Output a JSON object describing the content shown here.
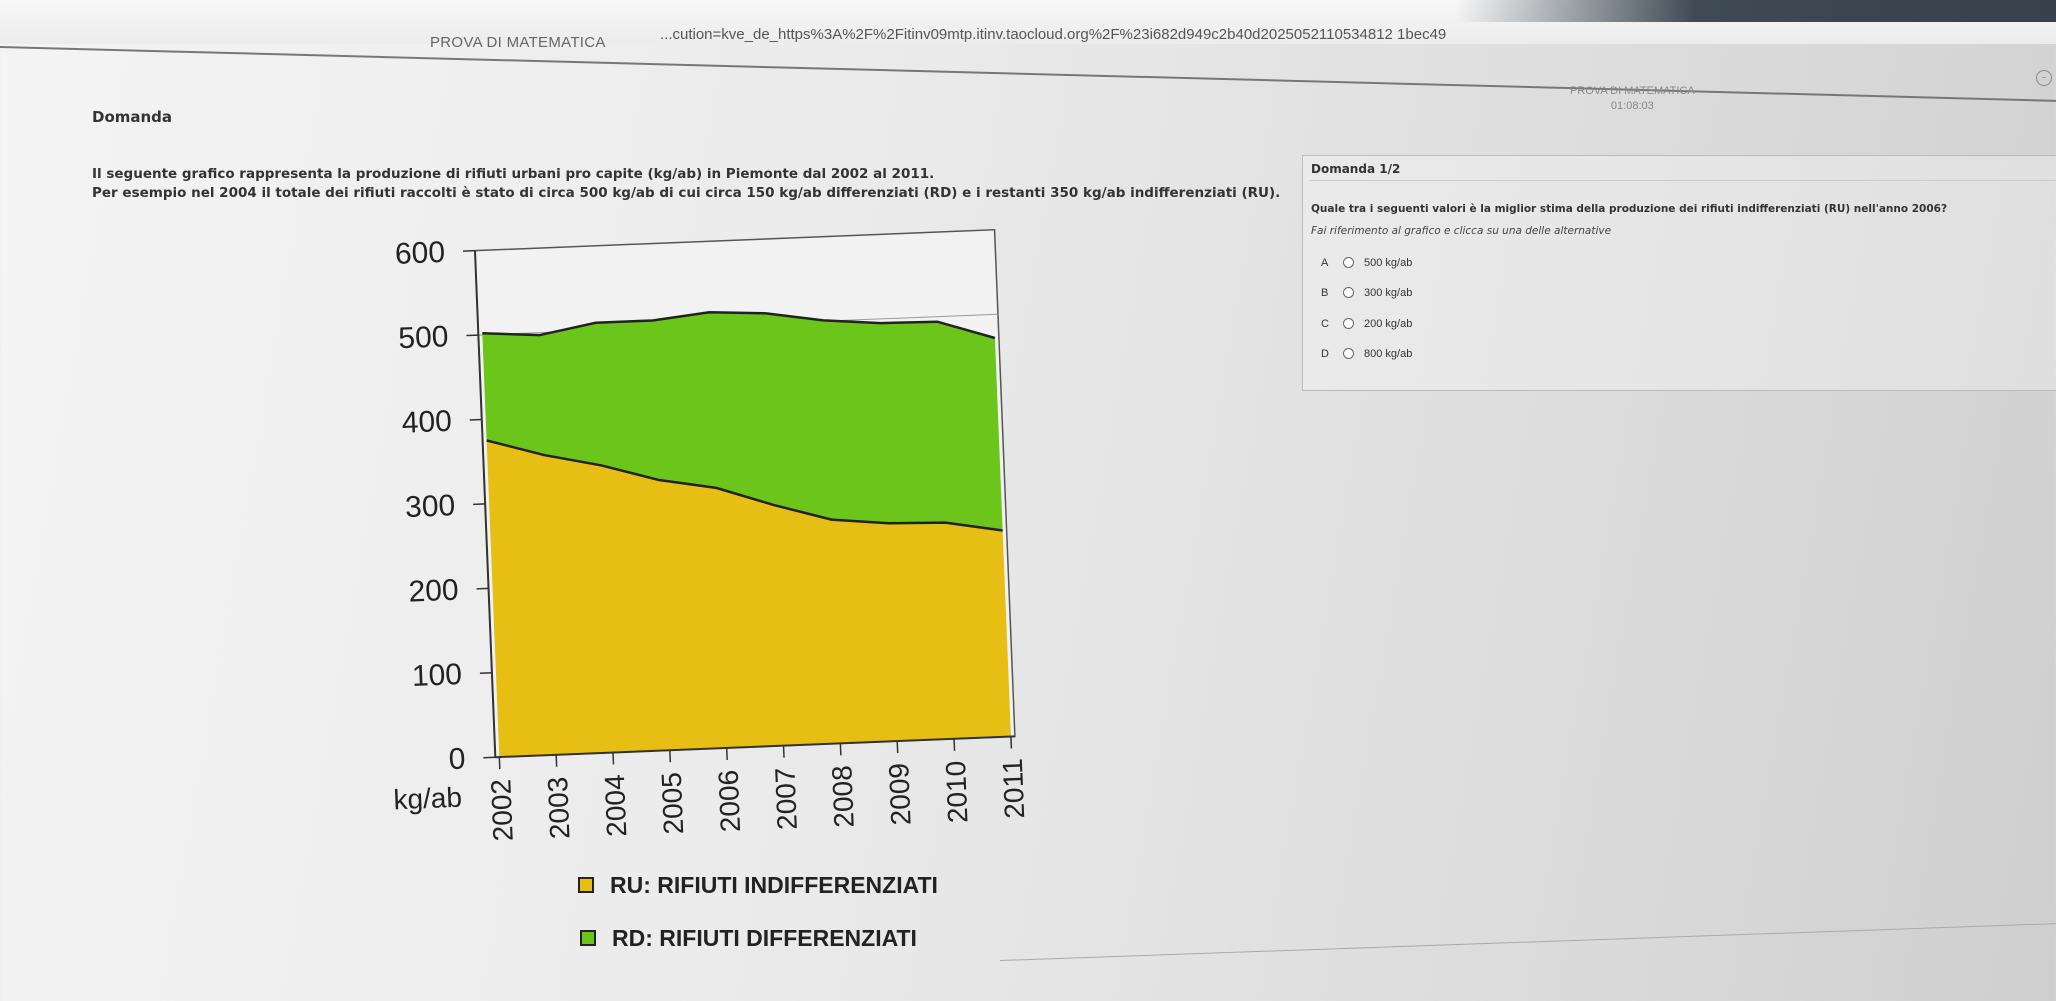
{
  "browser": {
    "url": "...cution=kve_de_https%3A%2F%2Fitinv09mtp.itinv.taocloud.org%2F%23i682d949c2b40d2025052110534812 1bec49"
  },
  "header": {
    "title": "PROVA DI MATEMATICA",
    "exam_name": "PROVA DI MATEMATICA",
    "timer": "01:08:03"
  },
  "section": {
    "label": "Domanda"
  },
  "question": {
    "line1": "Il seguente grafico rappresenta la produzione di rifiuti urbani pro capite (kg/ab) in Piemonte dal 2002 al 2011.",
    "line2": "Per esempio nel 2004 il totale dei rifiuti raccolti è stato di circa 500 kg/ab di cui circa 150 kg/ab differenziati (RD) e i restanti 350 kg/ab indifferenziati (RU)."
  },
  "chart_data": {
    "type": "area",
    "stacked": true,
    "x": [
      "2002",
      "2003",
      "2004",
      "2005",
      "2006",
      "2007",
      "2008",
      "2009",
      "2010",
      "2011"
    ],
    "ylabel": "kg/ab",
    "ylim": [
      0,
      600
    ],
    "yticks": [
      "0",
      "100",
      "200",
      "300",
      "400",
      "500",
      "600"
    ],
    "series": [
      {
        "name": "RU: RIFIUTI INDIFFERENZIATI",
        "color": "#e6be14",
        "values": [
          375,
          355,
          340,
          320,
          308,
          285,
          265,
          258,
          256,
          244
        ]
      },
      {
        "name": "RD: RIFIUTI DIFFERENZIATI",
        "color": "#6cc51a",
        "values": [
          127,
          142,
          169,
          189,
          208,
          227,
          236,
          237,
          238,
          228
        ]
      }
    ],
    "total_line": [
      502,
      497,
      509,
      509,
      516,
      512,
      501,
      495,
      494,
      472
    ],
    "grid": "horizontal line at 500",
    "legend_position": "bottom"
  },
  "panel": {
    "title": "Domanda 1/2",
    "question": "Quale tra i seguenti valori è la miglior stima della produzione dei rifiuti indifferenziati (RU) nell'anno 2006?",
    "hint": "Fai riferimento al grafico e clicca su una delle alternative",
    "options": [
      {
        "letter": "A",
        "label": "500 kg/ab"
      },
      {
        "letter": "B",
        "label": "300 kg/ab"
      },
      {
        "letter": "C",
        "label": "200 kg/ab"
      },
      {
        "letter": "D",
        "label": "800 kg/ab"
      }
    ]
  },
  "colors": {
    "accent": "#3f4a55"
  }
}
